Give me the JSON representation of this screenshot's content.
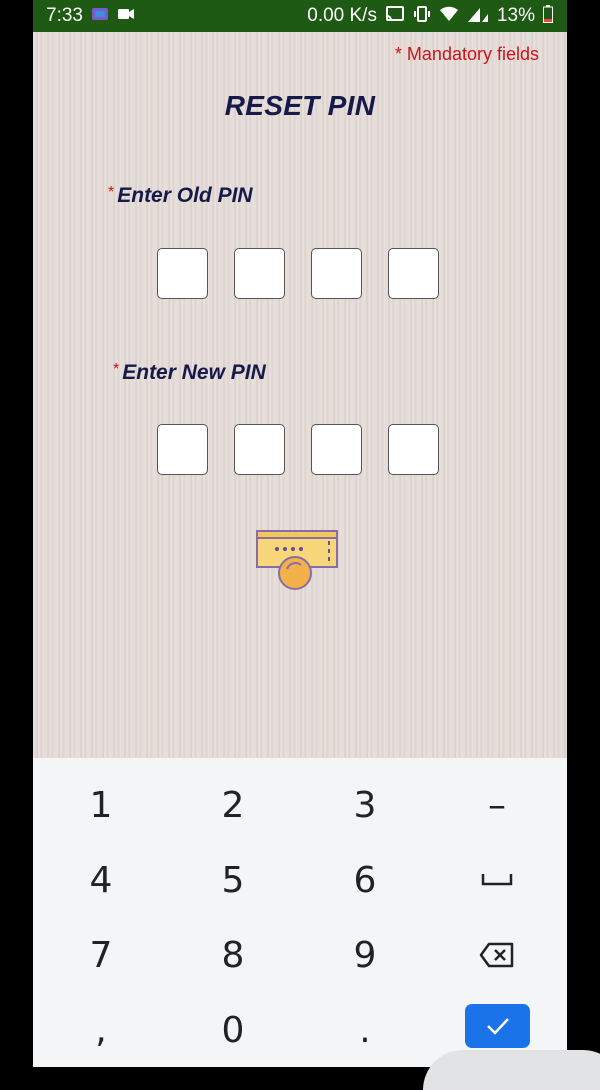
{
  "status_bar": {
    "time": "7:33",
    "speed": "0.00 K/s",
    "battery": "13%"
  },
  "screen": {
    "mandatory_note": "* Mandatory fields",
    "title": "RESET PIN",
    "old_pin_label": "Enter Old PIN",
    "new_pin_label": "Enter New PIN",
    "required_marker": "*",
    "pin_length": 4
  },
  "keyboard": {
    "keys": [
      "1",
      "2",
      "3",
      "–",
      "4",
      "5",
      "6",
      "␣",
      "7",
      "8",
      "9",
      "⌫",
      ",",
      "0",
      "."
    ],
    "done_icon": "checkmark-icon"
  },
  "colors": {
    "status_bar": "#1e5a14",
    "title": "#151a4b",
    "required": "#c8151b",
    "done_button": "#1a73e8"
  }
}
